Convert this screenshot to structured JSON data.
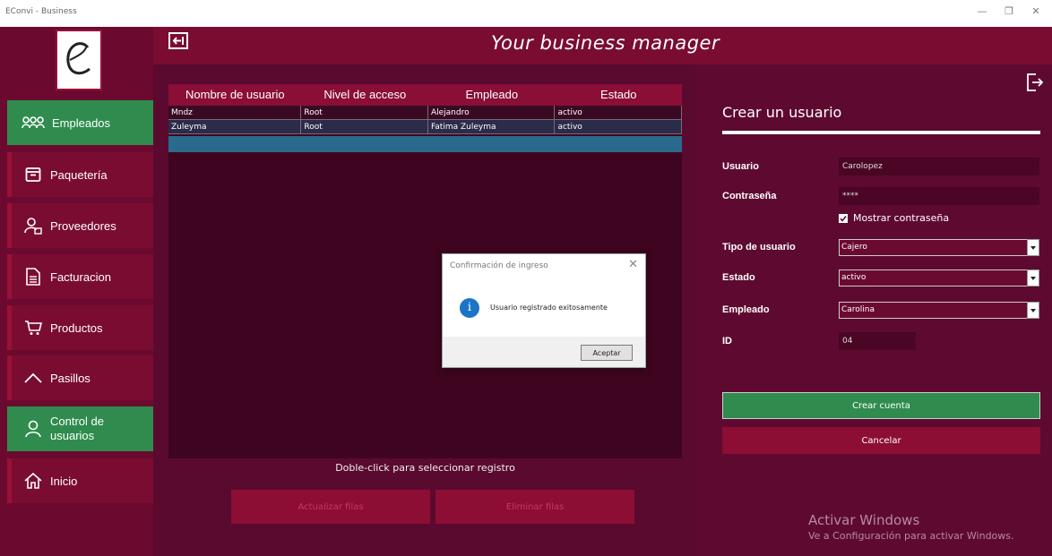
{
  "window": {
    "title": "EConvi - Business",
    "controls": [
      "—",
      "❐",
      "✕"
    ]
  },
  "header": {
    "title": "Your business manager"
  },
  "sidebar": {
    "items": [
      {
        "label": "Empleados",
        "icon": "group-icon",
        "active": true
      },
      {
        "label": "Paquetería",
        "icon": "package-icon",
        "active": false
      },
      {
        "label": "Proveedores",
        "icon": "supplier-icon",
        "active": false
      },
      {
        "label": "Facturacion",
        "icon": "document-icon",
        "active": false
      },
      {
        "label": "Productos",
        "icon": "cart-icon",
        "active": false
      },
      {
        "label": "Pasillos",
        "icon": "chevron-up-icon",
        "active": false
      },
      {
        "label": "Control de usuarios",
        "icon": "user-icon",
        "active": true
      },
      {
        "label": "Inicio",
        "icon": "home-icon",
        "active": false
      }
    ]
  },
  "grid": {
    "columns": [
      "Nombre de usuario",
      "Nivel de acceso",
      "Empleado",
      "Estado"
    ],
    "rows": [
      [
        "Mndz",
        "Root",
        "Alejandro",
        "activo"
      ],
      [
        "Zuleyma",
        "Root",
        "Fatima Zuleyma",
        "activo"
      ]
    ]
  },
  "main": {
    "hint": "Doble-click para seleccionar registro",
    "update_label": "Actualizar filas",
    "delete_label": "Eliminar filas"
  },
  "form": {
    "title": "Crear un usuario",
    "usuario_label": "Usuario",
    "usuario_value": "Carolopez",
    "password_label": "Contraseña",
    "password_value": "****",
    "show_password_label": "Mostrar contraseña",
    "show_password_checked": true,
    "tipo_label": "Tipo de usuario",
    "tipo_value": "Cajero",
    "estado_label": "Estado",
    "estado_value": "activo",
    "empleado_label": "Empleado",
    "empleado_value": "Carolina",
    "id_label": "ID",
    "id_value": "04",
    "create_label": "Crear cuenta",
    "cancel_label": "Cancelar"
  },
  "activation": {
    "line1": "Activar Windows",
    "line2": "Ve a Configuración para activar Windows."
  },
  "dialog": {
    "title": "Confirmación de ingreso",
    "message": "Usuario registrado exitosamente",
    "ok_label": "Aceptar"
  },
  "colors": {
    "primary": "#7a0c32",
    "accent_green": "#2f8c4e",
    "background": "#5e0a30"
  }
}
